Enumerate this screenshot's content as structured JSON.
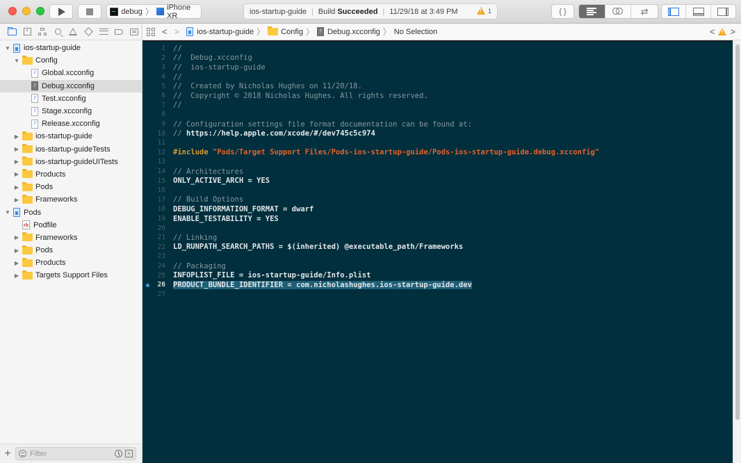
{
  "toolbar": {
    "scheme": "debug",
    "device": "iPhone XR",
    "activity": {
      "project": "ios-startup-guide",
      "status_prefix": "Build",
      "status": "Succeeded",
      "timestamp": "11/29/18 at 3:49 PM",
      "warning_count": "1"
    },
    "library_label": "{ }",
    "editor_modes": [
      "standard-editor",
      "assistant-editor",
      "version-editor"
    ],
    "active_editor_mode": "standard-editor",
    "view_toggles": [
      "navigator",
      "debug-area",
      "inspectors"
    ]
  },
  "navigator_tabs": [
    "project-navigator",
    "source-control-navigator",
    "symbol-navigator",
    "find-navigator",
    "issue-navigator",
    "test-navigator",
    "debug-navigator",
    "breakpoint-navigator",
    "report-navigator"
  ],
  "jumpbar": {
    "crumbs": [
      "ios-startup-guide",
      "Config",
      "Debug.xcconfig",
      "No Selection"
    ]
  },
  "navigator": {
    "items": [
      {
        "label": "ios-startup-guide",
        "indent": 0,
        "type": "project",
        "disclosure": "open"
      },
      {
        "label": "Config",
        "indent": 1,
        "type": "folder",
        "disclosure": "open"
      },
      {
        "label": "Global.xcconfig",
        "indent": 2,
        "type": "xcconfig",
        "disclosure": "none"
      },
      {
        "label": "Debug.xcconfig",
        "indent": 2,
        "type": "xcconfig",
        "disclosure": "none",
        "selected": true
      },
      {
        "label": "Test.xcconfig",
        "indent": 2,
        "type": "xcconfig",
        "disclosure": "none"
      },
      {
        "label": "Stage.xcconfig",
        "indent": 2,
        "type": "xcconfig",
        "disclosure": "none"
      },
      {
        "label": "Release.xcconfig",
        "indent": 2,
        "type": "xcconfig",
        "disclosure": "none"
      },
      {
        "label": "ios-startup-guide",
        "indent": 1,
        "type": "folder",
        "disclosure": "closed"
      },
      {
        "label": "ios-startup-guideTests",
        "indent": 1,
        "type": "folder",
        "disclosure": "closed"
      },
      {
        "label": "ios-startup-guideUITests",
        "indent": 1,
        "type": "folder",
        "disclosure": "closed"
      },
      {
        "label": "Products",
        "indent": 1,
        "type": "folder",
        "disclosure": "closed"
      },
      {
        "label": "Pods",
        "indent": 1,
        "type": "folder",
        "disclosure": "closed"
      },
      {
        "label": "Frameworks",
        "indent": 1,
        "type": "folder",
        "disclosure": "closed"
      },
      {
        "label": "Pods",
        "indent": 0,
        "type": "project",
        "disclosure": "open"
      },
      {
        "label": "Podfile",
        "indent": 1,
        "type": "ruby",
        "disclosure": "none"
      },
      {
        "label": "Frameworks",
        "indent": 1,
        "type": "folder",
        "disclosure": "closed"
      },
      {
        "label": "Pods",
        "indent": 1,
        "type": "folder",
        "disclosure": "closed"
      },
      {
        "label": "Products",
        "indent": 1,
        "type": "folder",
        "disclosure": "closed"
      },
      {
        "label": "Targets Support Files",
        "indent": 1,
        "type": "folder",
        "disclosure": "closed"
      }
    ]
  },
  "filter": {
    "placeholder": "Filter",
    "value": ""
  },
  "editor": {
    "current_line": 26,
    "lines": [
      [
        {
          "t": "cmt",
          "v": "//"
        }
      ],
      [
        {
          "t": "cmt",
          "v": "//  Debug.xcconfig"
        }
      ],
      [
        {
          "t": "cmt",
          "v": "//  ios-startup-guide"
        }
      ],
      [
        {
          "t": "cmt",
          "v": "//"
        }
      ],
      [
        {
          "t": "cmt",
          "v": "//  Created by Nicholas Hughes on 11/20/18."
        }
      ],
      [
        {
          "t": "cmt",
          "v": "//  Copyright © 2018 Nicholas Hughes. All rights reserved."
        }
      ],
      [
        {
          "t": "cmt",
          "v": "//"
        }
      ],
      [],
      [
        {
          "t": "cmt",
          "v": "// Configuration settings file format documentation can be found at:"
        }
      ],
      [
        {
          "t": "cmt",
          "v": "// "
        },
        {
          "t": "url",
          "v": "https://help.apple.com/xcode/#/dev745c5c974"
        }
      ],
      [],
      [
        {
          "t": "pp",
          "v": "#include "
        },
        {
          "t": "str",
          "v": "\"Pods/Target Support Files/Pods-ios-startup-guide/Pods-ios-startup-guide.debug.xcconfig\""
        }
      ],
      [],
      [
        {
          "t": "cmt",
          "v": "// Architectures"
        }
      ],
      [
        {
          "t": "plain",
          "v": "ONLY_ACTIVE_ARCH = YES"
        }
      ],
      [],
      [
        {
          "t": "cmt",
          "v": "// Build Options"
        }
      ],
      [
        {
          "t": "plain",
          "v": "DEBUG_INFORMATION_FORMAT = dwarf"
        }
      ],
      [
        {
          "t": "plain",
          "v": "ENABLE_TESTABILITY = YES"
        }
      ],
      [],
      [
        {
          "t": "cmt",
          "v": "// Linking"
        }
      ],
      [
        {
          "t": "plain",
          "v": "LD_RUNPATH_SEARCH_PATHS = $(inherited) @executable_path/Frameworks"
        }
      ],
      [],
      [
        {
          "t": "cmt",
          "v": "// Packaging"
        }
      ],
      [
        {
          "t": "plain",
          "v": "INFOPLIST_FILE = ios-startup-guide/Info.plist"
        }
      ],
      [
        {
          "t": "hl",
          "v": "PRODUCT_BUNDLE_IDENTIFIER = com.nicholashughes.ios-startup-guide.dev"
        }
      ],
      []
    ]
  },
  "colors": {
    "editor_bg": "#012f3d",
    "comment": "#8697a0",
    "preprocessor": "#d79a36",
    "string": "#e2622b",
    "selection": "#1f5f77",
    "accent": "#2a7ae2",
    "warning": "#f5a623"
  }
}
